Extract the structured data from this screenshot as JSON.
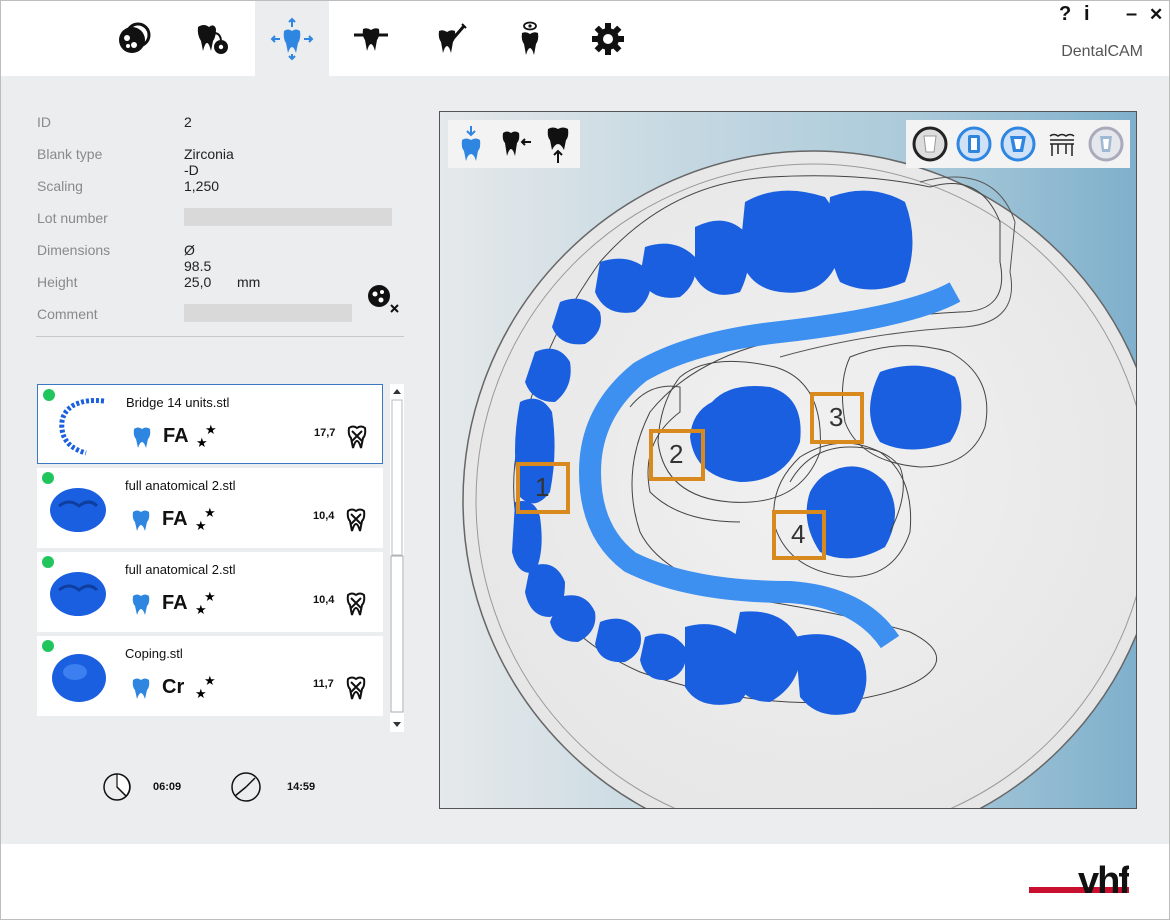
{
  "app": {
    "brand": "DentalCAM",
    "help": "?",
    "info": "i",
    "minimize": "–",
    "close": "✕"
  },
  "toolbar": {
    "icons": [
      "blank-icon",
      "tooth-exchange-icon",
      "tooth-position-icon",
      "tooth-align-icon",
      "tooth-tool-icon",
      "tooth-view-icon",
      "settings-gear-icon"
    ],
    "active_index": 2
  },
  "info": {
    "id_label": "ID",
    "id_value": "2",
    "blank_type_label": "Blank type",
    "blank_type_value": "Zirconia -D",
    "scaling_label": "Scaling",
    "scaling_value": "1,250",
    "lot_label": "Lot number",
    "dimensions_label": "Dimensions",
    "dimensions_value": "Ø 98.5",
    "height_label": "Height",
    "height_value": "25,0",
    "height_unit": "mm",
    "comment_label": "Comment"
  },
  "jobs": [
    {
      "name": "Bridge 14 units.stl",
      "type": "FA",
      "value": "17,7",
      "status_color": "#21c55d"
    },
    {
      "name": "full anatomical 2.stl",
      "type": "FA",
      "value": "10,4",
      "status_color": "#21c55d"
    },
    {
      "name": "full anatomical 2.stl",
      "type": "FA",
      "value": "10,4",
      "status_color": "#21c55d"
    },
    {
      "name": "Coping.stl",
      "type": "Cr",
      "value": "11,7",
      "status_color": "#21c55d"
    }
  ],
  "times": {
    "calc_time": "06:09",
    "mill_time": "14:59"
  },
  "viewport": {
    "markers": [
      "1",
      "2",
      "3",
      "4"
    ],
    "left_tools": [
      "tooth-down-arrow-icon",
      "tooth-left-arrow-icon",
      "tooth-up-arrow-icon"
    ],
    "right_tools": [
      "blank-outline-icon",
      "blank-blue-icon",
      "tooth-blue-icon",
      "tooth-bridge-icon",
      "tooth-grey-icon"
    ]
  },
  "colors": {
    "accent": "#2f86e0",
    "tooth_blue": "#1a5fe0",
    "marker": "#d98a1e",
    "status_green": "#21c55d"
  },
  "logo": {
    "text": "vhf"
  }
}
